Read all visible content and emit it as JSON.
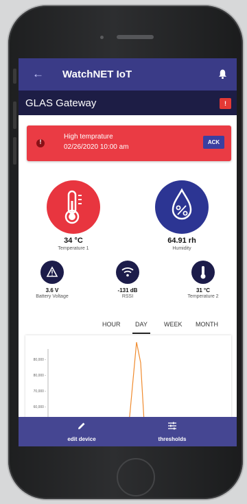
{
  "app": {
    "title": "WatchNET IoT"
  },
  "device": {
    "title": "GLAS Gateway"
  },
  "alert": {
    "title": "High temprature",
    "time": "02/26/2020 10:00 am",
    "ack_label": "ACK",
    "color": "#ea3b44"
  },
  "sensors_main": [
    {
      "value": "34 °C",
      "label": "Temperature 1",
      "icon": "thermometer-icon",
      "color": "#e8353f"
    },
    {
      "value": "64.91 rh",
      "label": "Humidity",
      "icon": "humidity-drop-icon",
      "color": "#2c3593"
    }
  ],
  "sensors_small": [
    {
      "value": "3.6 V",
      "label": "Battery Voltage",
      "icon": "warning-icon"
    },
    {
      "value": "-131 dB",
      "label": "RSSI",
      "icon": "wifi-icon"
    },
    {
      "value": "31 °C",
      "label": "Temperature 2",
      "icon": "thermometer-icon"
    }
  ],
  "tabs": [
    {
      "label": "HOUR",
      "active": false
    },
    {
      "label": "DAY",
      "active": true
    },
    {
      "label": "WEEK",
      "active": false
    },
    {
      "label": "MONTH",
      "active": false
    }
  ],
  "chart": {
    "y_ticks": [
      "80,000 -",
      "80,000 -",
      "70,000 -",
      "60,000 -"
    ],
    "line_color": "#f08a2c"
  },
  "bottom_bar": {
    "edit_label": "edit device",
    "thresholds_label": "thresholds"
  },
  "colors": {
    "appbar": "#3a3b87",
    "subbar": "#1d1d45",
    "bottom_bar": "#454692"
  }
}
